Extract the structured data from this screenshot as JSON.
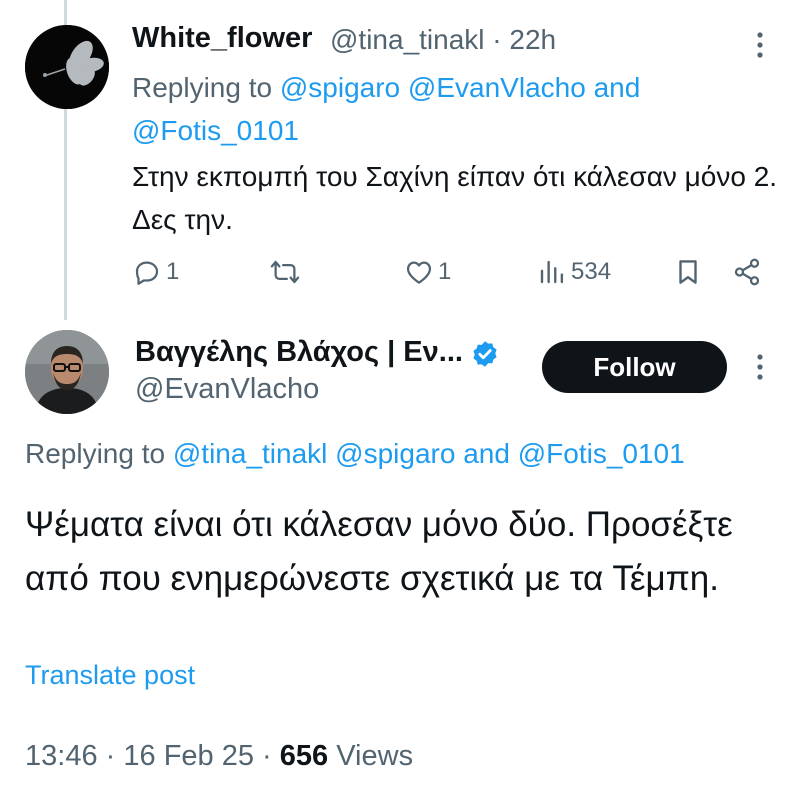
{
  "reply": {
    "display_name": "White_flower",
    "handle": "@tina_tinakl",
    "separator": "·",
    "time": "22h",
    "replying_prefix": "Replying to",
    "mention_1": "@spigaro",
    "mention_2": "@EvanVlacho",
    "conjunction": "and",
    "mention_3": "@Fotis_0101",
    "body": "Στην εκπομπή του Σαχίνη είπαν ότι κάλεσαν μόνο 2. Δες την.",
    "reply_count": "1",
    "retweet_count": "",
    "like_count": "1",
    "view_count": "534"
  },
  "main": {
    "display_name": "Βαγγέλης Βλάχος | Εν...",
    "handle": "@EvanVlacho",
    "follow_label": "Follow",
    "replying_prefix": "Replying to",
    "mention_1": "@tina_tinakl",
    "mention_2": "@spigaro",
    "conjunction": "and",
    "mention_3": "@Fotis_0101",
    "body": "Ψέματα είναι ότι κάλεσαν μόνο δύο. Προσέξτε από που ενημερώνεστε σχετικά με τα Τέμπη.",
    "translate_label": "Translate post",
    "time": "13:46",
    "date": "16 Feb 25",
    "views_count": "656",
    "views_label": "Views"
  },
  "icons": [
    "reply-icon",
    "retweet-icon",
    "like-icon",
    "views-icon",
    "bookmark-icon",
    "share-icon",
    "more-icon",
    "verified-icon"
  ],
  "colors": {
    "link": "#1d9bf0",
    "secondary_text": "#536471",
    "primary_text": "#0f1419",
    "verified": "#1d9bf0"
  }
}
